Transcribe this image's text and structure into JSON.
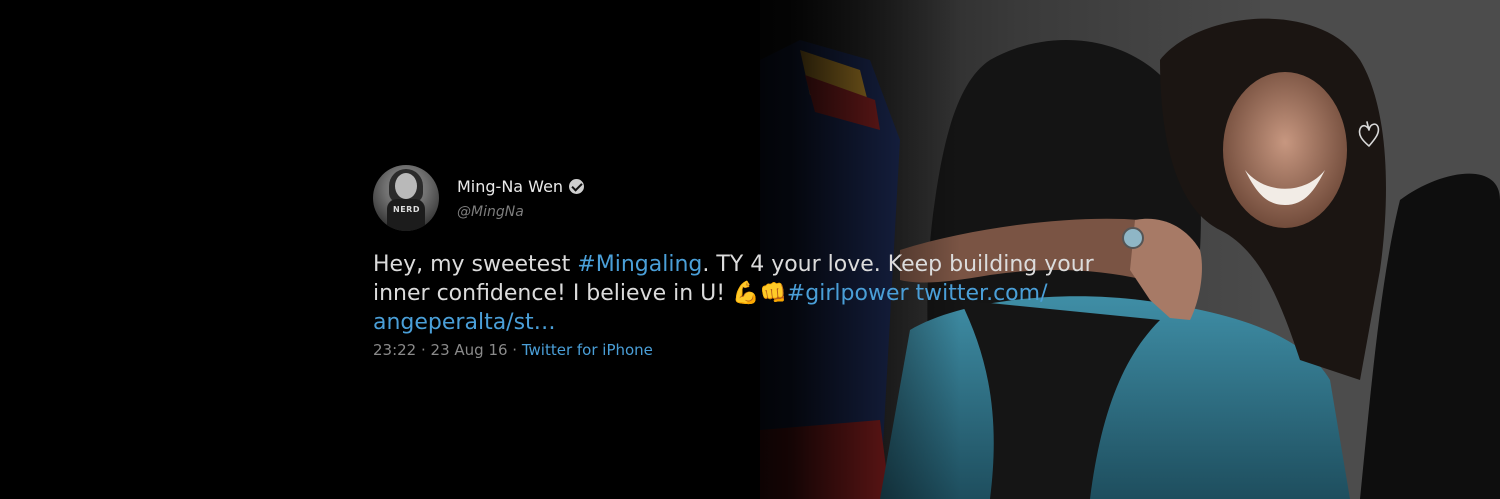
{
  "tweet": {
    "display_name": "Ming-Na Wen",
    "handle": "@MingNa",
    "avatar_shirt_text": "NERD",
    "text_part1": "Hey, my sweetest ",
    "hashtag1": "#Mingaling",
    "text_part2": ". TY 4 your love. Keep building your inner confidence! I believe in U! ",
    "emoji": "💪👊",
    "hashtag2": "#girlpower",
    "link": " twitter.com/ angeperalta/st…",
    "time": "23:22 · 23 Aug 16 · ",
    "source": "Twitter for iPhone"
  },
  "colors": {
    "background": "#000000",
    "link": "#4a9fd8",
    "text": "#dcdcdc",
    "meta": "#8a8a8a"
  },
  "icons": {
    "verified": "verified-badge-icon",
    "heart": "heart-doodle-icon"
  }
}
